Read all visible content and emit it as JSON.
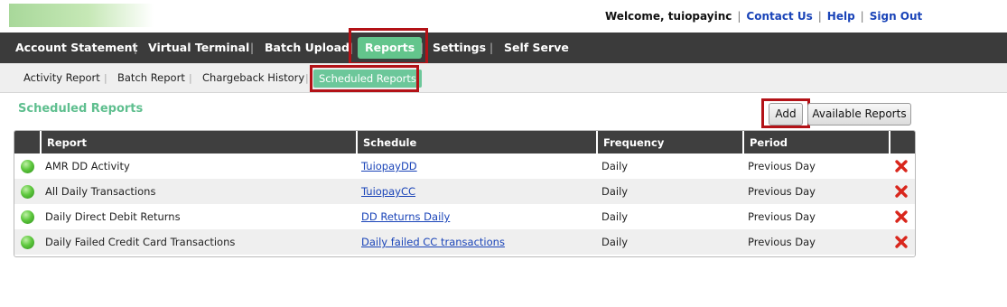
{
  "header": {
    "welcome": "Welcome, tuiopayinc",
    "links": [
      "Contact Us",
      "Help",
      "Sign Out"
    ]
  },
  "main_nav": {
    "items": [
      "Account Statement",
      "Virtual Terminal",
      "Batch Upload",
      "Reports",
      "Settings",
      "Self Serve"
    ],
    "active": "Reports"
  },
  "sub_nav": {
    "items": [
      "Activity Report",
      "Batch Report",
      "Chargeback History",
      "Scheduled Reports"
    ],
    "active": "Scheduled Reports"
  },
  "section_title": "Scheduled Reports",
  "buttons": {
    "add": "Add",
    "available_reports": "Available Reports"
  },
  "table": {
    "columns": [
      "Report",
      "Schedule",
      "Frequency",
      "Period"
    ],
    "rows": [
      {
        "report": "AMR DD Activity",
        "schedule": "TuiopayDD",
        "frequency": "Daily",
        "period": "Previous Day"
      },
      {
        "report": "All Daily Transactions",
        "schedule": "TuiopayCC",
        "frequency": "Daily",
        "period": "Previous Day"
      },
      {
        "report": "Daily Direct Debit Returns",
        "schedule": "DD Returns Daily",
        "frequency": "Daily",
        "period": "Previous Day"
      },
      {
        "report": "Daily Failed Credit Card Transactions",
        "schedule": "Daily failed CC transactions",
        "frequency": "Daily",
        "period": "Previous Day"
      }
    ]
  },
  "colors": {
    "nav_bg": "#3b3b3b",
    "active_green": "#63c58c",
    "title_green": "#5fbf8f",
    "link_blue": "#1a44b8",
    "highlight_red": "#b31217",
    "delete_red": "#d9261c"
  },
  "icons": {
    "status": "green-dot-icon",
    "delete": "red-x-icon"
  }
}
